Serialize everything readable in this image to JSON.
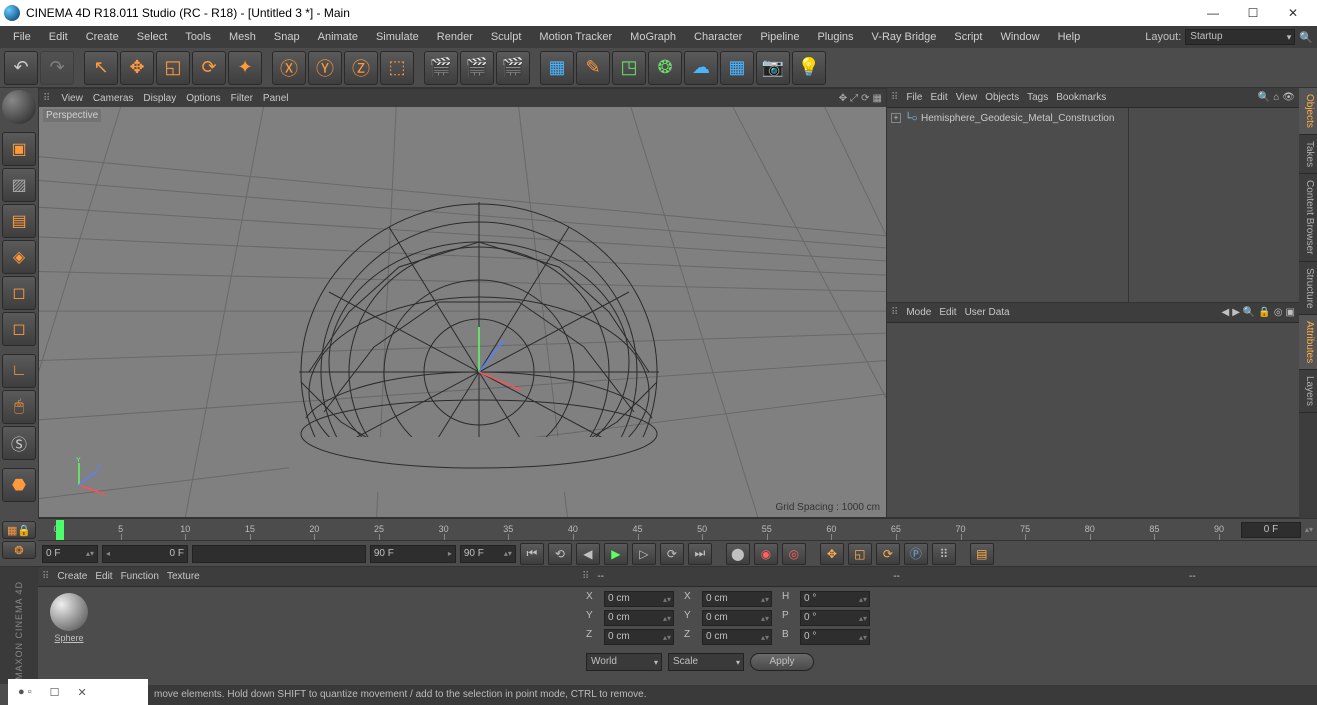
{
  "window": {
    "title": "CINEMA 4D R18.011 Studio (RC - R18) - [Untitled 3 *] - Main"
  },
  "menu": {
    "items": [
      "File",
      "Edit",
      "Create",
      "Select",
      "Tools",
      "Mesh",
      "Snap",
      "Animate",
      "Simulate",
      "Render",
      "Sculpt",
      "Motion Tracker",
      "MoGraph",
      "Character",
      "Pipeline",
      "Plugins",
      "V-Ray Bridge",
      "Script",
      "Window",
      "Help"
    ],
    "layout_label": "Layout:",
    "layout_value": "Startup"
  },
  "viewport_menu": {
    "items": [
      "View",
      "Cameras",
      "Display",
      "Options",
      "Filter",
      "Panel"
    ],
    "label": "Perspective",
    "footer": "Grid Spacing : 1000 cm"
  },
  "objects_panel": {
    "menu": [
      "File",
      "Edit",
      "View",
      "Objects",
      "Tags",
      "Bookmarks"
    ],
    "item_name": "Hemisphere_Geodesic_Metal_Construction"
  },
  "attr_panel": {
    "menu": [
      "Mode",
      "Edit",
      "User Data"
    ]
  },
  "side_tabs": {
    "objects": "Objects",
    "takes": "Takes",
    "content": "Content Browser",
    "structure": "Structure",
    "attributes": "Attributes",
    "layers": "Layers"
  },
  "timeline": {
    "ticks": [
      "0",
      "5",
      "10",
      "15",
      "20",
      "25",
      "30",
      "35",
      "40",
      "45",
      "50",
      "55",
      "60",
      "65",
      "70",
      "75",
      "80",
      "85",
      "90"
    ],
    "end": "0 F",
    "f1": "0 F",
    "f2": "0 F",
    "f3": "90 F",
    "f4": "90 F"
  },
  "material_menu": {
    "items": [
      "Create",
      "Edit",
      "Function",
      "Texture"
    ],
    "mat_name": "Sphere"
  },
  "coords": {
    "menu": "--",
    "x_lbl": "X",
    "y_lbl": "Y",
    "z_lbl": "Z",
    "sx_lbl": "X",
    "sy_lbl": "Y",
    "sz_lbl": "Z",
    "h_lbl": "H",
    "p_lbl": "P",
    "b_lbl": "B",
    "px": "0 cm",
    "py": "0 cm",
    "pz": "0 cm",
    "sx": "0 cm",
    "sy": "0 cm",
    "sz": "0 cm",
    "rh": "0 °",
    "rp": "0 °",
    "rb": "0 °",
    "world": "World",
    "scale": "Scale",
    "apply": "Apply"
  },
  "statusbar": "move elements. Hold down SHIFT to quantize movement / add to the selection in point mode, CTRL to remove.",
  "logo": "MAXON   CINEMA 4D"
}
